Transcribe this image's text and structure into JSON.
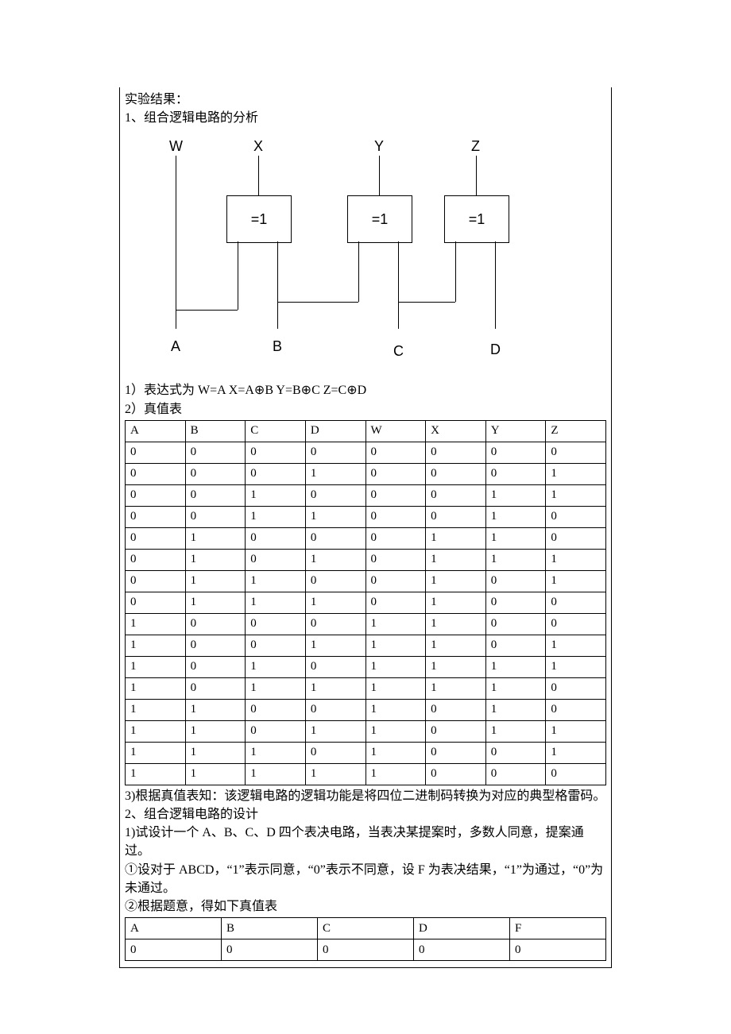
{
  "headings": {
    "results": "实验结果：",
    "section1": "1、组合逻辑电路的分析",
    "expr_label": "1）表达式为 W=A X=A⊕B Y=B⊕C Z=C⊕D",
    "truth_label": "2）真值表",
    "conclusion": "3)根据真值表知：该逻辑电路的逻辑功能是将四位二进制码转换为对应的典型格雷码。",
    "section2": "2、组合逻辑电路的设计",
    "design1": "1)试设计一个 A、B、C、D 四个表决电路，当表决某提案时，多数人同意，提案通过。",
    "design_step1": "①设对于 ABCD，“1”表示同意，“0”表示不同意，设 F 为表决结果，“1”为通过，“0”为未通过。",
    "design_step2": "②根据题意，得如下真值表"
  },
  "diagram": {
    "top_labels": [
      "W",
      "X",
      "Y",
      "Z"
    ],
    "bottom_labels": [
      "A",
      "B",
      "C",
      "D"
    ],
    "gate_text": "=1"
  },
  "truth_table": {
    "header": [
      "A",
      "B",
      "C",
      "D",
      "W",
      "X",
      "Y",
      "Z"
    ],
    "rows": [
      [
        "0",
        "0",
        "0",
        "0",
        "0",
        "0",
        "0",
        "0"
      ],
      [
        "0",
        "0",
        "0",
        "1",
        "0",
        "0",
        "0",
        "1"
      ],
      [
        "0",
        "0",
        "1",
        "0",
        "0",
        "0",
        "1",
        "1"
      ],
      [
        "0",
        "0",
        "1",
        "1",
        "0",
        "0",
        "1",
        "0"
      ],
      [
        "0",
        "1",
        "0",
        "0",
        "0",
        "1",
        "1",
        "0"
      ],
      [
        "0",
        "1",
        "0",
        "1",
        "0",
        "1",
        "1",
        "1"
      ],
      [
        "0",
        "1",
        "1",
        "0",
        "0",
        "1",
        "0",
        "1"
      ],
      [
        "0",
        "1",
        "1",
        "1",
        "0",
        "1",
        "0",
        "0"
      ],
      [
        "1",
        "0",
        "0",
        "0",
        "1",
        "1",
        "0",
        "0"
      ],
      [
        "1",
        "0",
        "0",
        "1",
        "1",
        "1",
        "0",
        "1"
      ],
      [
        "1",
        "0",
        "1",
        "0",
        "1",
        "1",
        "1",
        "1"
      ],
      [
        "1",
        "0",
        "1",
        "1",
        "1",
        "1",
        "1",
        "0"
      ],
      [
        "1",
        "1",
        "0",
        "0",
        "1",
        "0",
        "1",
        "0"
      ],
      [
        "1",
        "1",
        "0",
        "1",
        "1",
        "0",
        "1",
        "1"
      ],
      [
        "1",
        "1",
        "1",
        "0",
        "1",
        "0",
        "0",
        "1"
      ],
      [
        "1",
        "1",
        "1",
        "1",
        "1",
        "0",
        "0",
        "0"
      ]
    ]
  },
  "vote_table": {
    "header": [
      "A",
      "B",
      "C",
      "D",
      "F"
    ],
    "rows": [
      [
        "0",
        "0",
        "0",
        "0",
        "0"
      ]
    ]
  }
}
